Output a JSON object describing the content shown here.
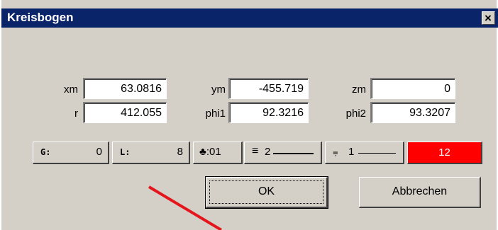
{
  "window": {
    "title": "Kreisbogen",
    "close_glyph": "×"
  },
  "fields": {
    "xm": {
      "label": "xm",
      "value": "63.0816"
    },
    "ym": {
      "label": "ym",
      "value": "-455.719"
    },
    "zm": {
      "label": "zm",
      "value": "0"
    },
    "r": {
      "label": "r",
      "value": "412.055"
    },
    "phi1": {
      "label": "phi1",
      "value": "92.3216"
    },
    "phi2": {
      "label": "phi2",
      "value": "93.3207"
    }
  },
  "attributes": {
    "group": {
      "label": "G:",
      "value": "0"
    },
    "layer": {
      "label": "L:",
      "value": "8"
    },
    "pen": {
      "label": "♣:01"
    },
    "linewidth": {
      "glyph": "≡",
      "value": "2"
    },
    "linetype": {
      "glyph": "⩦",
      "value": "1"
    },
    "color": {
      "value": "12",
      "hex": "#ff0000"
    }
  },
  "buttons": {
    "ok": "OK",
    "cancel": "Abbrechen"
  }
}
